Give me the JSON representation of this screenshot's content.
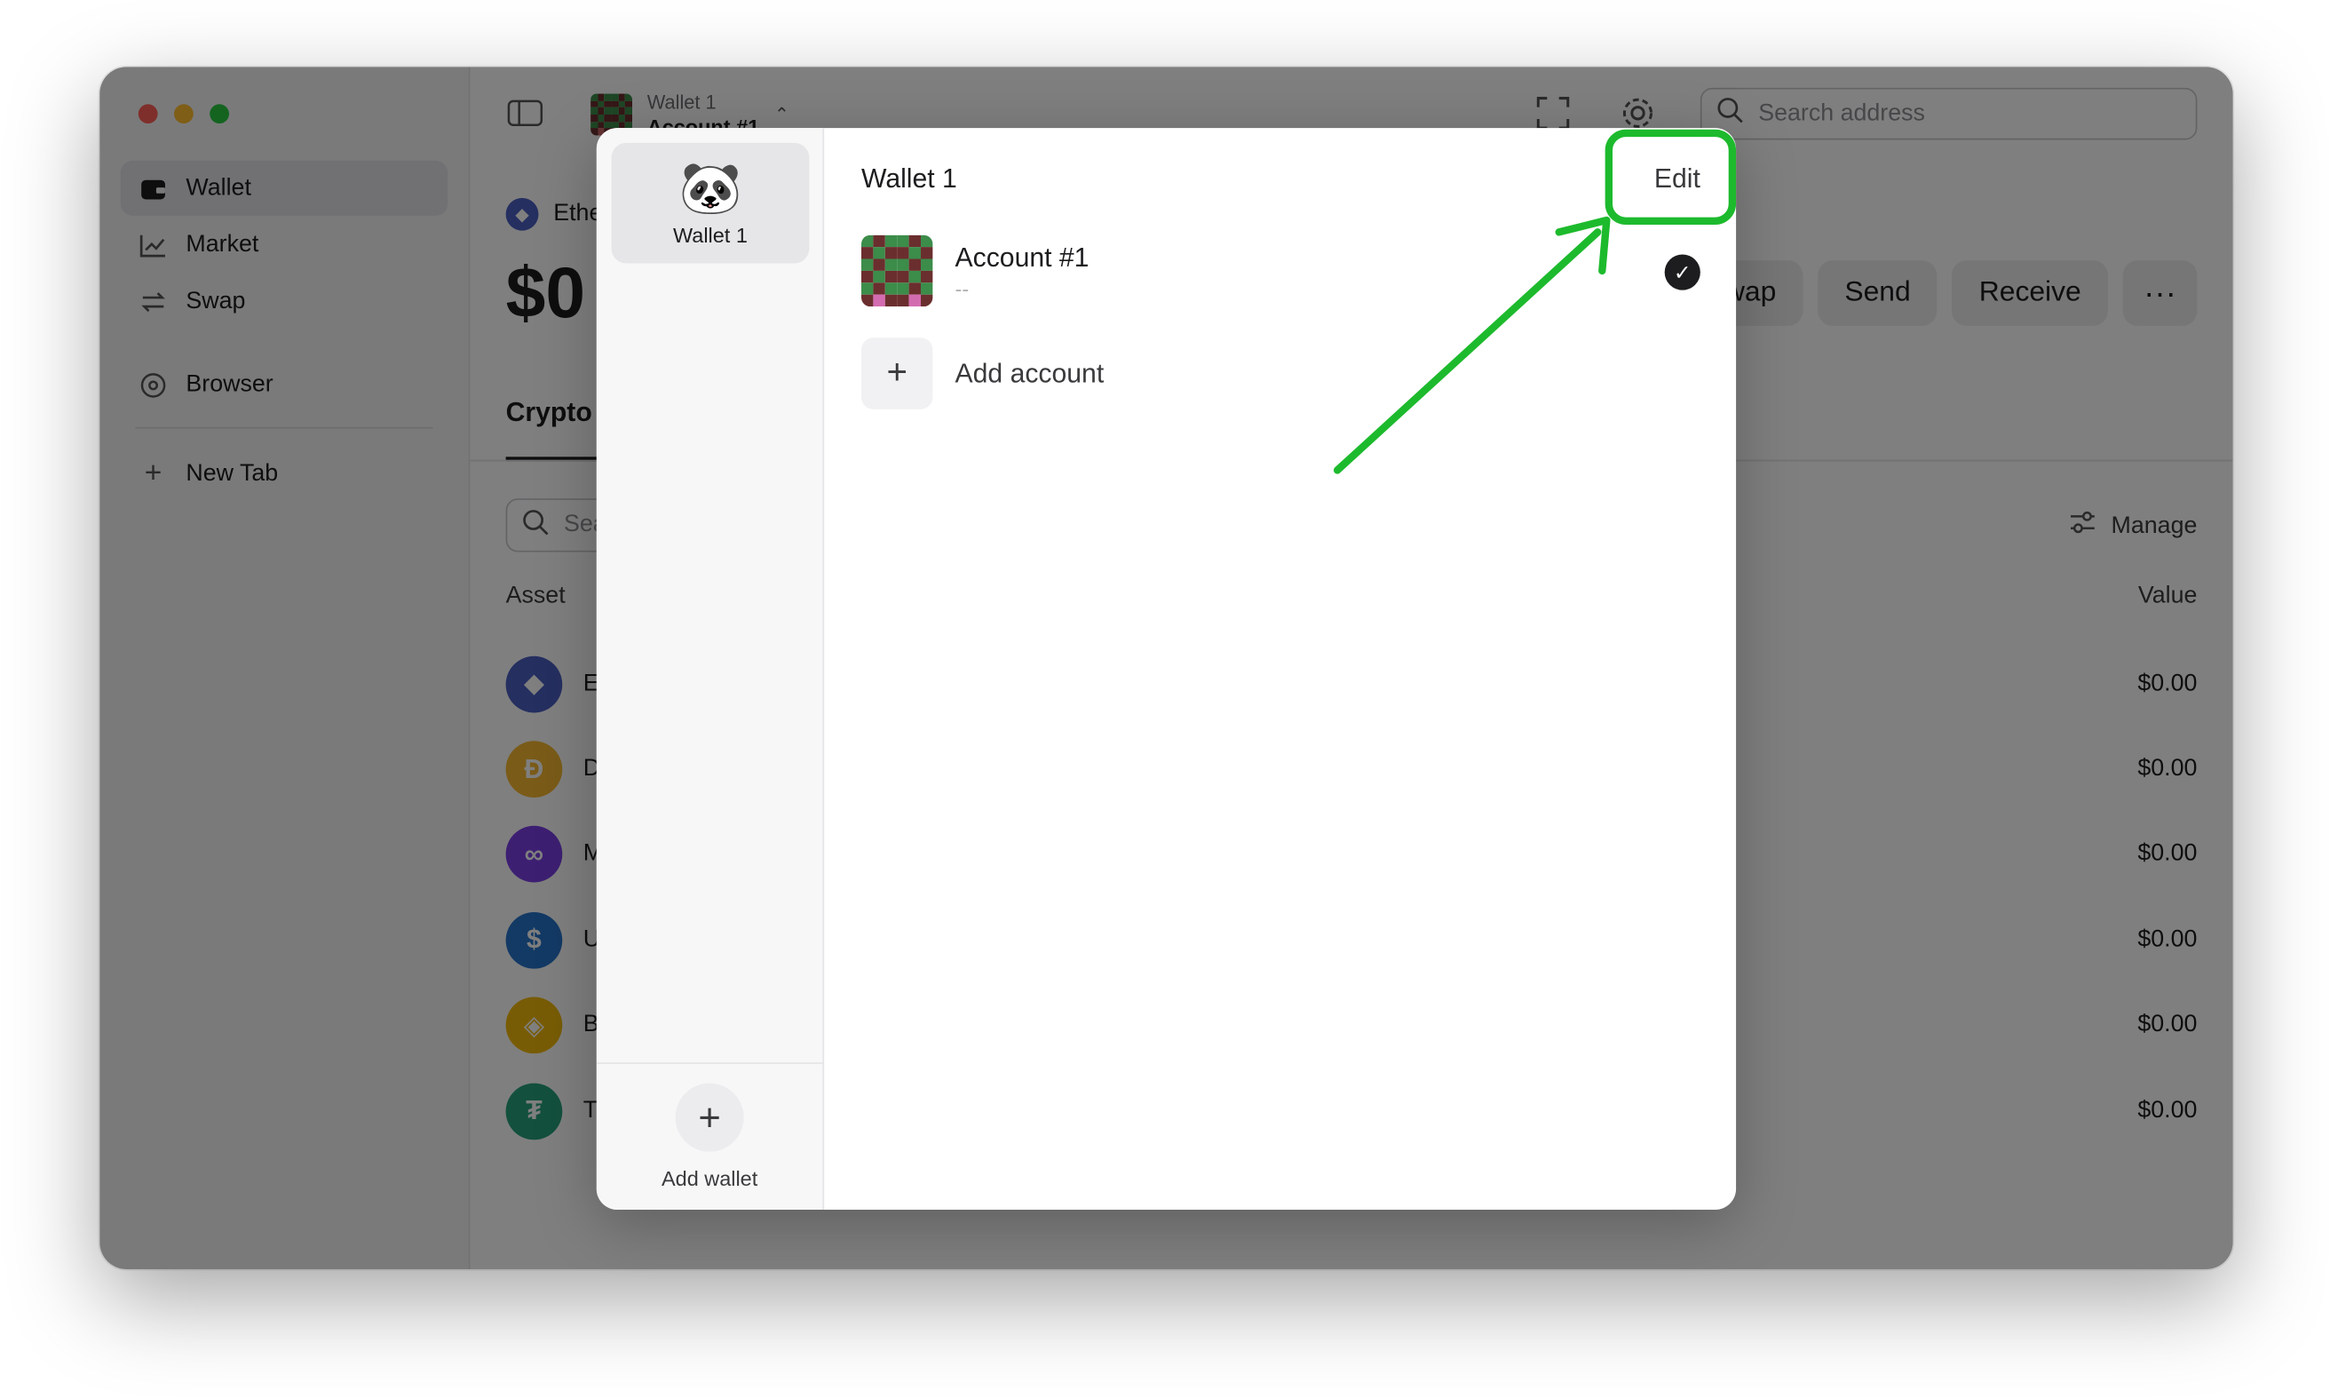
{
  "colors": {
    "accent_highlight": "#1dba2d",
    "overlay": "rgba(0,0,0,0.5)"
  },
  "sidebar": {
    "items": [
      {
        "label": "Wallet",
        "icon": "wallet-icon"
      },
      {
        "label": "Market",
        "icon": "chart-icon"
      },
      {
        "label": "Swap",
        "icon": "swap-arrows-icon"
      },
      {
        "label": "Browser",
        "icon": "compass-icon"
      },
      {
        "label": "New Tab",
        "icon": "plus-icon"
      }
    ]
  },
  "topbar": {
    "wallet_name": "Wallet 1",
    "account_name": "Account #1",
    "search_placeholder": "Search address"
  },
  "main": {
    "chain_label": "Ethe",
    "balance": "$0",
    "actions": [
      "wap",
      "Send",
      "Receive"
    ],
    "tab": "Crypto",
    "asset_search_placeholder": "Sea",
    "manage_label": "Manage",
    "col_asset": "Asset",
    "col_value": "Value",
    "assets": [
      {
        "letter": "E",
        "value": "$0.00",
        "color": "#4a5fc1"
      },
      {
        "letter": "D",
        "value": "$0.00",
        "color": "#f4b731"
      },
      {
        "letter": "M",
        "value": "$0.00",
        "color": "#7b3fe4"
      },
      {
        "letter": "U",
        "value": "$0.00",
        "color": "#2775ca"
      },
      {
        "letter": "B",
        "value": "$0.00",
        "color": "#f0b90b"
      },
      {
        "letter": "T",
        "value": "$0.00",
        "color": "#26a17b"
      }
    ]
  },
  "modal": {
    "wallet_tile_label": "Wallet 1",
    "add_wallet_label": "Add wallet",
    "title": "Wallet 1",
    "edit_label": "Edit",
    "account": {
      "name": "Account #1",
      "sub": "--"
    },
    "add_account_label": "Add account"
  }
}
